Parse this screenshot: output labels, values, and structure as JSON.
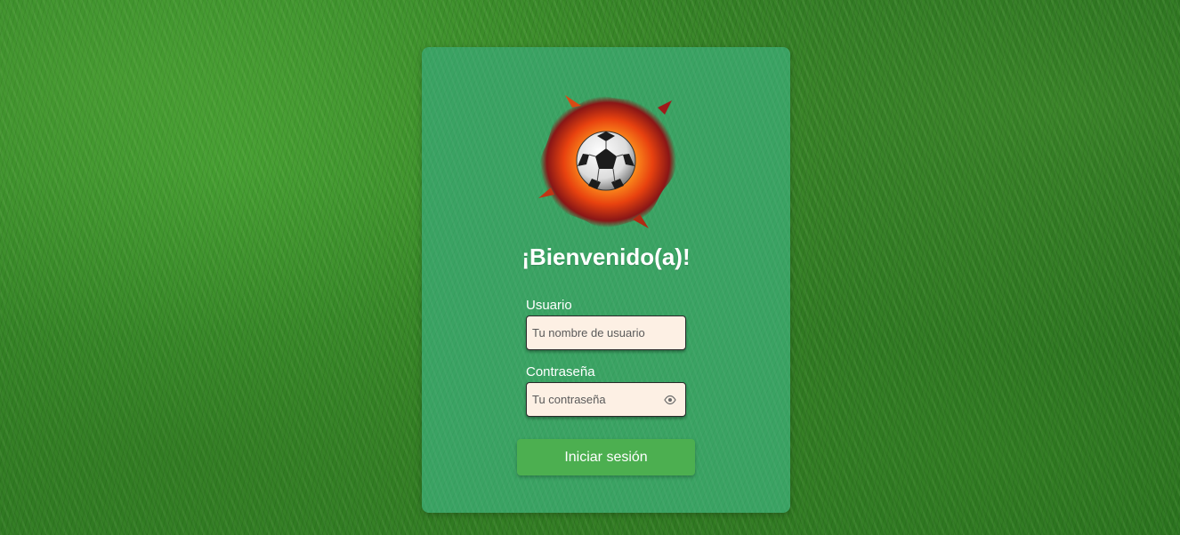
{
  "login": {
    "logo_icon": "flaming-soccer-ball-icon",
    "title": "¡Bienvenido(a)!",
    "username": {
      "label": "Usuario",
      "placeholder": "Tu nombre de usuario",
      "value": ""
    },
    "password": {
      "label": "Contraseña",
      "placeholder": "Tu contraseña",
      "value": "",
      "toggle_icon": "eye-icon"
    },
    "submit_label": "Iniciar sesión"
  },
  "colors": {
    "card_background": "#3aa363",
    "button_background": "#4caf50",
    "input_background": "#fdf0e4",
    "text": "#ffffff"
  }
}
